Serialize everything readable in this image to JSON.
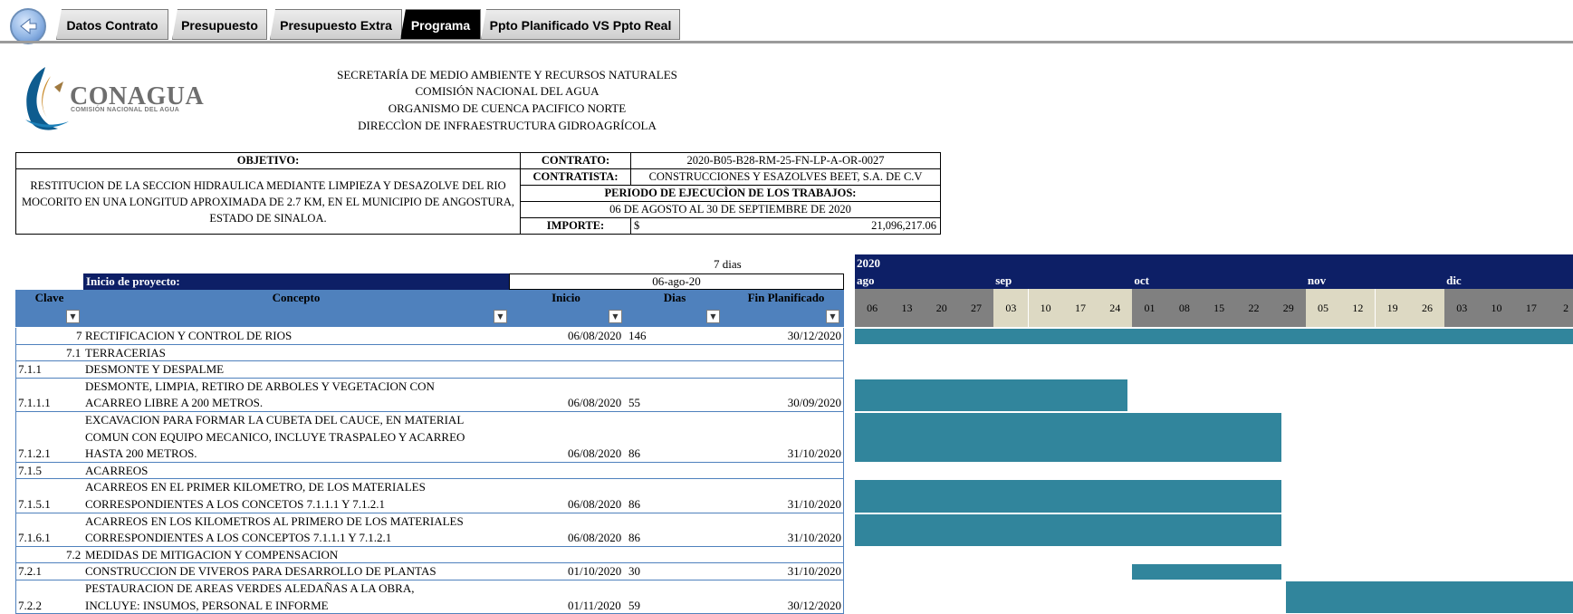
{
  "tabs": [
    "Datos Contrato",
    "Presupuesto",
    "Presupuesto Extra",
    "Programa",
    "Ppto Planificado VS Ppto Real"
  ],
  "active_tab": "Programa",
  "logo": {
    "name": "CONAGUA",
    "sub": "COMISIÓN NACIONAL DEL AGUA"
  },
  "header_lines": [
    "SECRETARÍA DE MEDIO AMBIENTE Y RECURSOS NATURALES",
    "COMISIÓN NACIONAL DEL AGUA",
    "ORGANISMO DE CUENCA PACIFICO NORTE",
    "DIRECCÌON DE INFRAESTRUCTURA GIDROAGRÍCOLA"
  ],
  "info": {
    "objetivo_label": "OBJETIVO:",
    "objetivo_text": "RESTITUCION DE LA SECCION HIDRAULICA MEDIANTE LIMPIEZA Y DESAZOLVE DEL RIO MOCORITO EN UNA LONGITUD APROXIMADA DE 2.7 KM, EN EL MUNICIPIO DE ANGOSTURA, ESTADO DE SINALOA.",
    "contrato_label": "CONTRATO:",
    "contrato": "2020-B05-B28-RM-25-FN-LP-A-OR-0027",
    "contratista_label": "CONTRATISTA:",
    "contratista": "CONSTRUCCIONES Y ESAZOLVES BEET, S.A. DE C.V",
    "periodo_label": "PERIODO DE EJECUCÌON DE LOS TRABAJOS:",
    "periodo": "06 DE AGOSTO AL 30 DE SEPTIEMBRE DE 2020",
    "importe_label": "IMPORTE:",
    "currency": "$",
    "importe": "21,096,217.06"
  },
  "days_note": "7 dias",
  "inicio_label": "Inicio de proyecto:",
  "inicio_value": "06-ago-20",
  "columns": [
    "Clave",
    "Concepto",
    "Inicio",
    "Dias",
    "Fin Planificado"
  ],
  "gantt": {
    "year": "2020",
    "months": [
      "ago",
      "sep",
      "oct",
      "nov",
      "dic"
    ],
    "weeks": [
      "06",
      "13",
      "20",
      "27",
      "03",
      "10",
      "17",
      "24",
      "01",
      "08",
      "15",
      "22",
      "29",
      "05",
      "12",
      "19",
      "26",
      "03",
      "10",
      "17",
      "2"
    ]
  },
  "rows": [
    {
      "clave": "",
      "num": "7",
      "concepto": [
        "RECTIFICACION Y CONTROL DE RIOS"
      ],
      "inicio": "06/08/2020",
      "dias": "146",
      "fin": "30/12/2020"
    },
    {
      "clave": "",
      "num": "7.1",
      "concepto": [
        "TERRACERIAS"
      ],
      "inicio": "",
      "dias": "",
      "fin": ""
    },
    {
      "clave": "7.1.1",
      "num": "",
      "concepto": [
        "DESMONTE Y DESPALME"
      ],
      "inicio": "",
      "dias": "",
      "fin": ""
    },
    {
      "clave": "7.1.1.1",
      "num": "",
      "concepto": [
        "DESMONTE, LIMPIA, RETIRO DE ARBOLES Y VEGETACION CON",
        "ACARREO LIBRE A 200 METROS."
      ],
      "inicio": "06/08/2020",
      "dias": "55",
      "fin": "30/09/2020"
    },
    {
      "clave": "7.1.2.1",
      "num": "",
      "concepto": [
        "EXCAVACION PARA FORMAR LA CUBETA DEL CAUCE, EN MATERIAL",
        "COMUN CON EQUIPO MECANICO, INCLUYE TRASPALEO Y ACARREO",
        "HASTA 200 METROS."
      ],
      "inicio": "06/08/2020",
      "dias": "86",
      "fin": "31/10/2020"
    },
    {
      "clave": "7.1.5",
      "num": "",
      "concepto": [
        "ACARREOS"
      ],
      "inicio": "",
      "dias": "",
      "fin": ""
    },
    {
      "clave": "7.1.5.1",
      "num": "",
      "concepto": [
        "ACARREOS EN EL PRIMER KILOMETRO, DE LOS MATERIALES",
        "CORRESPONDIENTES A LOS CONCETOS 7.1.1.1 Y 7.1.2.1"
      ],
      "inicio": "06/08/2020",
      "dias": "86",
      "fin": "31/10/2020"
    },
    {
      "clave": "7.1.6.1",
      "num": "",
      "concepto": [
        "ACARREOS EN LOS KILOMETROS AL PRIMERO DE LOS MATERIALES",
        "CORRESPONDIENTES A LOS CONCEPTOS 7.1.1.1 Y 7.1.2.1"
      ],
      "inicio": "06/08/2020",
      "dias": "86",
      "fin": "31/10/2020"
    },
    {
      "clave": "",
      "num": "7.2",
      "concepto": [
        "MEDIDAS DE MITIGACION Y COMPENSACION"
      ],
      "inicio": "",
      "dias": "",
      "fin": ""
    },
    {
      "clave": "7.2.1",
      "num": "",
      "concepto": [
        "CONSTRUCCION DE VIVEROS PARA DESARROLLO DE PLANTAS"
      ],
      "inicio": "01/10/2020",
      "dias": "30",
      "fin": "31/10/2020"
    },
    {
      "clave": "7.2.2",
      "num": "",
      "concepto": [
        "PESTAURACION DE AREAS VERDES ALEDAÑAS A LA OBRA,",
        "INCLUYE: INSUMOS, PERSONAL E INFORME"
      ],
      "inicio": "01/11/2020",
      "dias": "59",
      "fin": "30/12/2020"
    }
  ],
  "colors": {
    "header_blue": "#4f81bd",
    "gantt_navy": "#0d1f66",
    "bar": "#31859c",
    "week_gray": "#808080",
    "week_tan": "#ddd9c3"
  }
}
